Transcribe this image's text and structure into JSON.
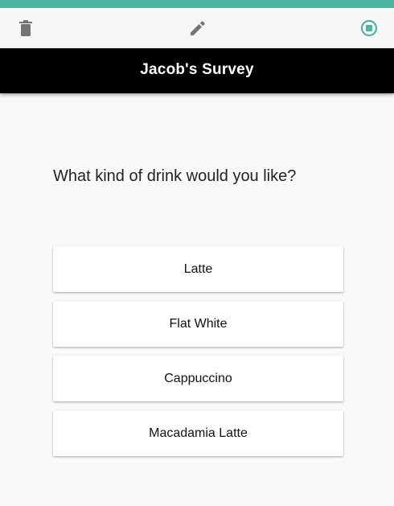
{
  "colors": {
    "accent_teal": "#4db6a0",
    "title_bar_bg": "#000000",
    "title_text": "#ffffff",
    "icon_gray": "#757575",
    "page_bg": "#f9f9f9"
  },
  "toolbar": {
    "icons": [
      "delete-icon",
      "edit-icon",
      "stop-icon"
    ]
  },
  "survey": {
    "title": "Jacob's Survey",
    "question": "What kind of drink would you like?",
    "options": [
      {
        "label": "Latte"
      },
      {
        "label": "Flat White"
      },
      {
        "label": "Cappuccino"
      },
      {
        "label": "Macadamia Latte"
      }
    ]
  }
}
